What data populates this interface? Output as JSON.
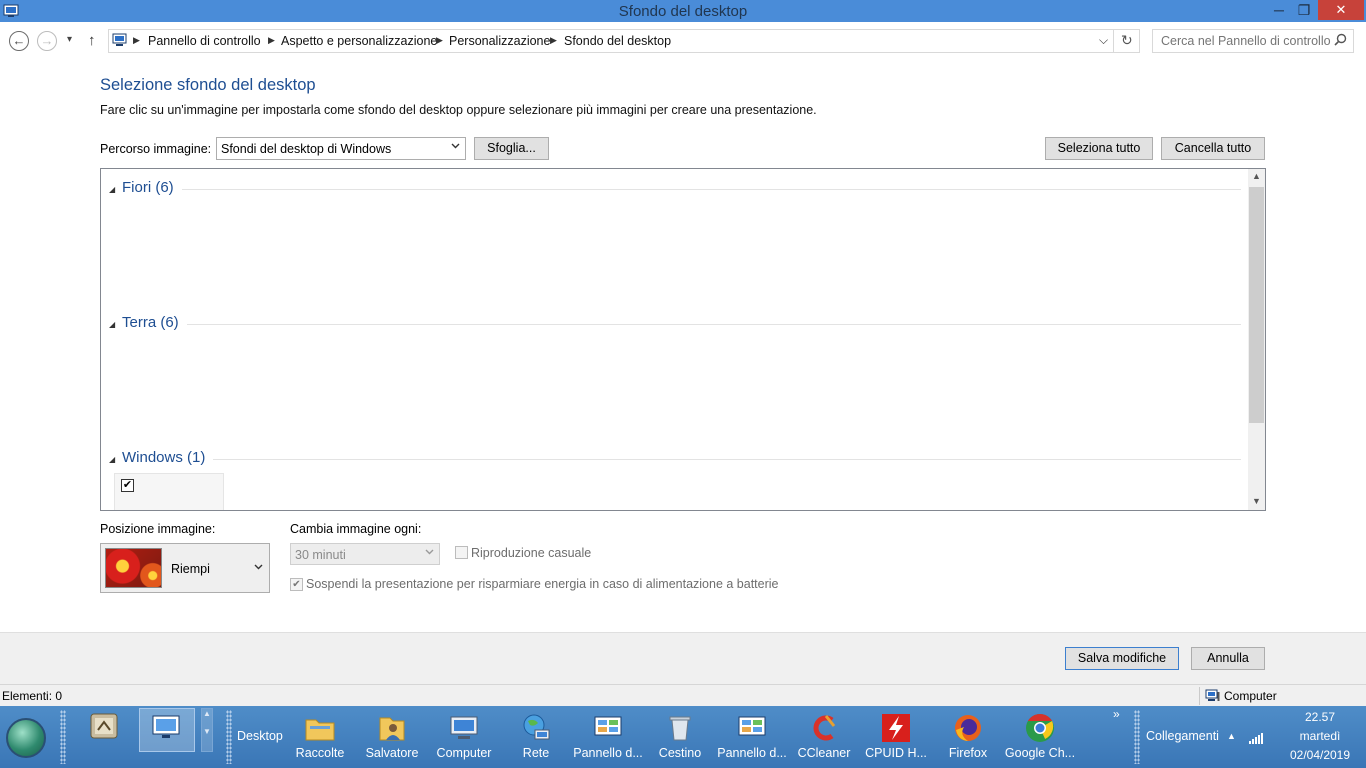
{
  "window": {
    "title": "Sfondo del desktop",
    "controls": {
      "minimize": "─",
      "restore": "❐",
      "close": "✕"
    }
  },
  "address": {
    "back": "←",
    "forward": "→",
    "recent": "▾",
    "up": "↑",
    "breadcrumbs": [
      "Pannello di controllo",
      "Aspetto e personalizzazione",
      "Personalizzazione",
      "Sfondo del desktop"
    ],
    "dropdown": "⌵",
    "refresh": "↻",
    "search_placeholder": "Cerca nel Pannello di controllo"
  },
  "main": {
    "heading": "Selezione sfondo del desktop",
    "description": "Fare clic su un'immagine per impostarla come sfondo del desktop oppure selezionare più immagini per creare una presentazione.",
    "path_label": "Percorso immagine:",
    "path_value": "Sfondi del desktop di Windows",
    "browse_label": "Sfoglia...",
    "select_all_label": "Seleziona tutto",
    "clear_all_label": "Cancella tutto",
    "groups": [
      {
        "name": "Fiori (6)"
      },
      {
        "name": "Terra (6)"
      },
      {
        "name": "Windows (1)"
      }
    ],
    "thumb_checked": "✔"
  },
  "options": {
    "position_label": "Posizione immagine:",
    "position_value": "Riempi",
    "interval_label": "Cambia immagine ogni:",
    "interval_value": "30 minuti",
    "shuffle_label": "Riproduzione casuale",
    "battery_label": "Sospendi la presentazione per risparmiare energia in caso di alimentazione a batterie",
    "battery_check": "✔"
  },
  "footer": {
    "save_label": "Salva modifiche",
    "cancel_label": "Annulla"
  },
  "status": {
    "left": "Elementi: 0",
    "right": "Computer"
  },
  "taskbar": {
    "desktop_label": "Desktop",
    "items": [
      "Raccolte",
      "Salvatore",
      "Computer",
      "Rete",
      "Pannello d...",
      "Cestino",
      "Pannello d...",
      "CCleaner",
      "CPUID H...",
      "Firefox",
      "Google Ch..."
    ],
    "more": "»",
    "links_label": "Collegamenti",
    "clock_time": "22.57",
    "clock_day": "martedì",
    "clock_date": "02/04/2019"
  },
  "colors": {
    "titlebar": "#4a8cd8",
    "heading": "#1e4e92",
    "taskbar": "#3f7dbd",
    "close": "#c7423a"
  }
}
